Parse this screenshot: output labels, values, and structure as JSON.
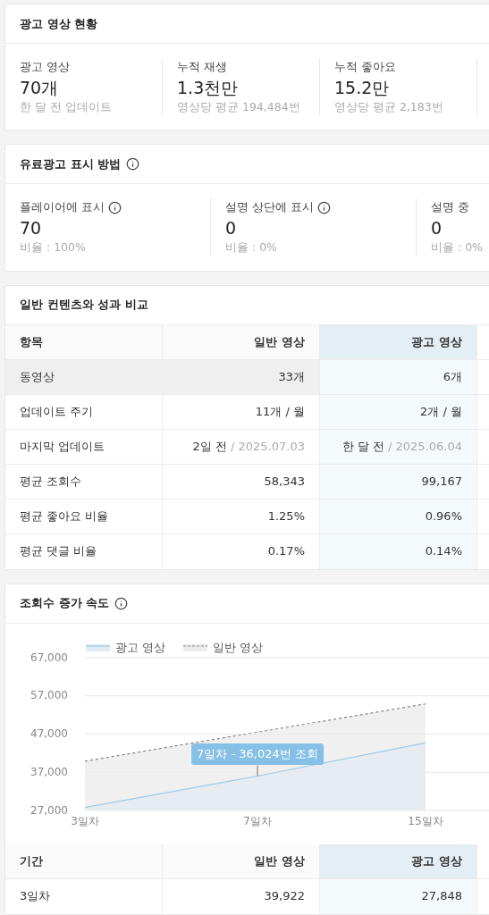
{
  "summary": {
    "title": "광고 영상 현황",
    "stats": [
      {
        "label": "광고 영상",
        "value": "70개",
        "note": "한 달 전 업데이트"
      },
      {
        "label": "누적 재생",
        "value": "1.3천만",
        "note": "영상당 평균 194,484번"
      },
      {
        "label": "누적 좋아요",
        "value": "15.2만",
        "note": "영상당 평균 2,183번"
      }
    ]
  },
  "placement": {
    "title": "유료광고 표시 방법",
    "stats": [
      {
        "label": "플레이어에 표시",
        "info": true,
        "value": "70",
        "note": "비율 : 100%"
      },
      {
        "label": "설명 상단에 표시",
        "info": true,
        "value": "0",
        "note": "비율 : 0%"
      },
      {
        "label": "설명 중",
        "info": false,
        "value": "0",
        "note": "비율 : 0%"
      }
    ]
  },
  "comparison": {
    "title": "일반 컨텐츠와 성과 비교",
    "columns": [
      "항목",
      "일반 영상",
      "광고 영상"
    ],
    "rows": [
      {
        "selected": true,
        "cells": [
          {
            "main": "동영상"
          },
          {
            "main": "33개"
          },
          {
            "main": "6개"
          }
        ]
      },
      {
        "selected": false,
        "cells": [
          {
            "main": "업데이트 주기"
          },
          {
            "main": "11개 / 월"
          },
          {
            "main": "2개 / 월"
          }
        ]
      },
      {
        "selected": false,
        "cells": [
          {
            "main": "마지막 업데이트"
          },
          {
            "main": "2일 전",
            "sub": "/ 2025.07.03"
          },
          {
            "main": "한 달 전",
            "sub": "/ 2025.06.04"
          }
        ]
      },
      {
        "selected": false,
        "cells": [
          {
            "main": "평균 조회수"
          },
          {
            "main": "58,343"
          },
          {
            "main": "99,167"
          }
        ]
      },
      {
        "selected": false,
        "cells": [
          {
            "main": "평균 좋아요 비율"
          },
          {
            "main": "1.25%"
          },
          {
            "main": "0.96%"
          }
        ]
      },
      {
        "selected": false,
        "cells": [
          {
            "main": "평균 댓글 비율"
          },
          {
            "main": "0.17%"
          },
          {
            "main": "0.14%"
          }
        ]
      }
    ]
  },
  "growth": {
    "title": "조회수 증가 속도",
    "chart_data": {
      "type": "area",
      "categories": [
        "3일차",
        "7일차",
        "15일차"
      ],
      "ylim": [
        27000,
        67000
      ],
      "yticks": [
        {
          "value": 27000,
          "label": "27,000"
        },
        {
          "value": 37000,
          "label": "37,000"
        },
        {
          "value": 47000,
          "label": "47,000"
        },
        {
          "value": 57000,
          "label": "57,000"
        },
        {
          "value": 67000,
          "label": "67,000"
        }
      ],
      "series": [
        {
          "name": "광고 영상",
          "color": "#9fcbe6",
          "values": [
            27800,
            36000,
            44700
          ]
        },
        {
          "name": "일반 영상",
          "color": "#888888",
          "values": [
            39900,
            47500,
            54900
          ]
        }
      ],
      "legend": true,
      "grid": true
    },
    "tooltip": "7일차 - 36,024번 조회",
    "table": {
      "columns": [
        "기간",
        "일반 영상",
        "광고 영상"
      ],
      "rows": [
        {
          "selected": false,
          "cells": [
            {
              "main": "3일차"
            },
            {
              "main": "39,922"
            },
            {
              "main": "27,848"
            }
          ]
        }
      ]
    }
  }
}
